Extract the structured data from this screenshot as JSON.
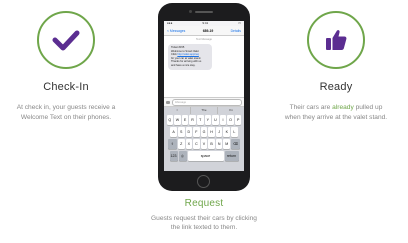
{
  "checkin": {
    "title": "Check-In",
    "desc_line1": "At check in, your guests receive a",
    "desc_line2": "Welcome Text on their phones.",
    "icon": "checkmark-icon"
  },
  "ready": {
    "title": "Ready",
    "desc_line1_a": "Their cars are ",
    "desc_line1_hl": "already",
    "desc_line1_b": " pulled up",
    "desc_line2": "when they arrive at the valet stand.",
    "icon": "thumbs-up-icon"
  },
  "request": {
    "title": "Request",
    "desc_line1": "Guests request their cars by clicking",
    "desc_line2": "the link texted to them."
  },
  "phone": {
    "status_time": "9:41",
    "nav_back": "< Messages",
    "nav_title": "689-19",
    "nav_details": "Details",
    "timestamp": "Text Message",
    "message_lines": [
      "Ticket #155",
      "Welcome to Smart Valet",
      "Click",
      "http://valet.app/req",
      "for your car at valet stand.",
      "Thanks for arriving with us",
      "and have a nice stay."
    ],
    "input_placeholder": "iMessage",
    "predictions": [
      "I",
      "The",
      "I'm"
    ],
    "keyboard_row1": [
      "Q",
      "W",
      "E",
      "R",
      "T",
      "Y",
      "U",
      "I",
      "O",
      "P"
    ],
    "keyboard_row2": [
      "A",
      "S",
      "D",
      "F",
      "G",
      "H",
      "J",
      "K",
      "L"
    ],
    "keyboard_row3": [
      "Z",
      "X",
      "C",
      "V",
      "B",
      "N",
      "M"
    ],
    "key_numbers": "123",
    "key_space": "space",
    "key_return": "return"
  },
  "colors": {
    "accent": "#6fa64a",
    "icon": "#5b2d91"
  }
}
